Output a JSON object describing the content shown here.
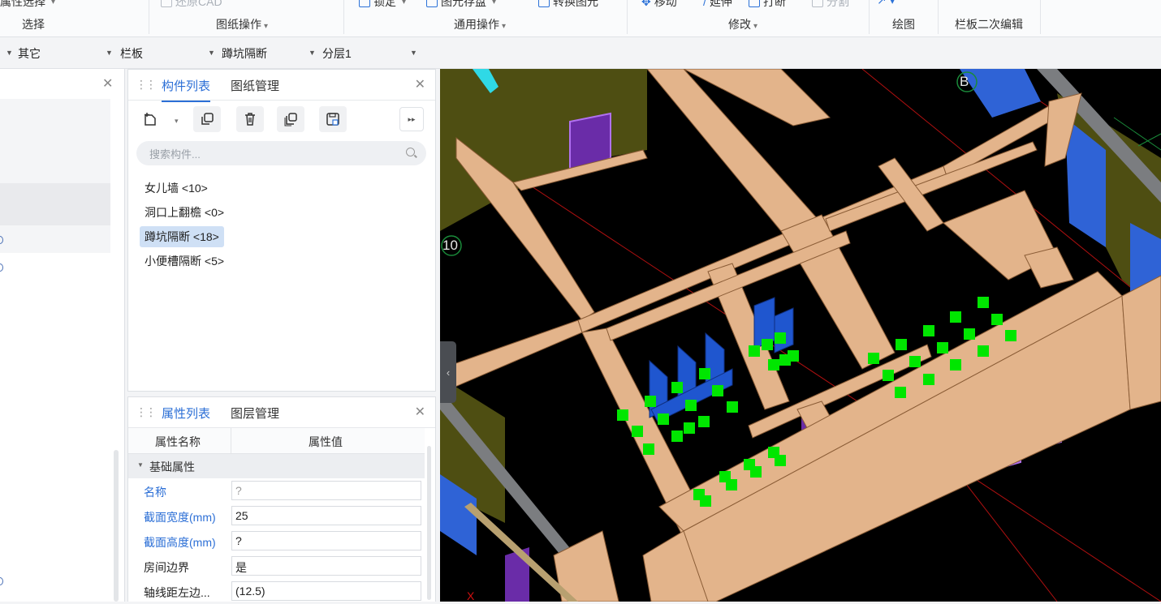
{
  "ribbon": {
    "top_items": [
      {
        "label": "属性选择",
        "dim": false
      },
      {
        "label": "还原CAD",
        "dim": true
      },
      {
        "label": "锁定",
        "dim": false
      },
      {
        "label": "图元存盘",
        "dim": false
      },
      {
        "label": "转换图元",
        "dim": false
      },
      {
        "label": "移动",
        "dim": false
      },
      {
        "label": "延伸",
        "dim": false
      },
      {
        "label": "打断",
        "dim": false
      },
      {
        "label": "分割",
        "dim": true
      }
    ],
    "groups": {
      "select": "选择",
      "drawing_ops": "图纸操作",
      "common_ops": "通用操作",
      "modify": "修改",
      "draw": "绘图",
      "railing_edit": "栏板二次编辑"
    }
  },
  "filters": {
    "type": "其它",
    "category": "栏板",
    "component": "蹲坑隔断",
    "layer": "分层1"
  },
  "component_panel": {
    "tabs": [
      "构件列表",
      "图纸管理"
    ],
    "search_placeholder": "搜索构件...",
    "items": [
      {
        "label": "女儿墙 <10>",
        "selected": false
      },
      {
        "label": "洞口上翻檐 <0>",
        "selected": false
      },
      {
        "label": "蹲坑隔断 <18>",
        "selected": true
      },
      {
        "label": "小便槽隔断 <5>",
        "selected": false
      }
    ]
  },
  "property_panel": {
    "tabs": [
      "属性列表",
      "图层管理"
    ],
    "col_name": "属性名称",
    "col_value": "属性值",
    "group": "基础属性",
    "rows": [
      {
        "name": "名称",
        "value": "?",
        "blue": true
      },
      {
        "name": "截面宽度(mm)",
        "value": "25",
        "blue": true
      },
      {
        "name": "截面高度(mm)",
        "value": "?",
        "blue": true
      },
      {
        "name": "房间边界",
        "value": "是",
        "blue": false
      },
      {
        "name": "轴线距左边...",
        "value": "(12.5)",
        "blue": false
      }
    ]
  },
  "viewport": {
    "axis_labels": [
      "B",
      "10"
    ],
    "colors": {
      "wall": "#e3b48b",
      "background": "#000000",
      "partition": "#1e55c8",
      "marker": "#00e600",
      "floor": "#5a5a14"
    }
  }
}
